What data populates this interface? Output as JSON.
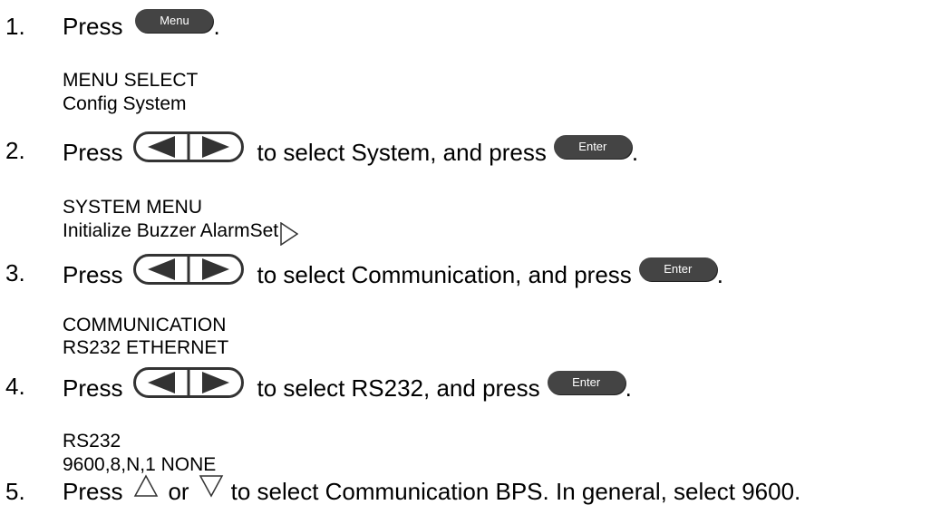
{
  "steps": [
    {
      "num": "1.",
      "pre": "Press",
      "key1": "Menu",
      "post": "."
    },
    {
      "num": "2.",
      "pre": "Press",
      "mid": "to select System, and press",
      "key2": "Enter",
      "post": "."
    },
    {
      "num": "3.",
      "pre": "Press",
      "mid": "to select Communication, and press",
      "key2": "Enter",
      "post": "."
    },
    {
      "num": "4.",
      "pre": "Press",
      "mid": "to select RS232, and press",
      "key2": "Enter",
      "post": "."
    },
    {
      "num": "5.",
      "pre": "Press",
      "or": "or",
      "mid": "to select Communication BPS. In general, select 9600."
    }
  ],
  "displays": [
    {
      "line1": "MENU SELECT",
      "line2": "Config System"
    },
    {
      "line1": "SYSTEM MENU",
      "line2": "Initialize Buzzer AlarmSet"
    },
    {
      "line1": "COMMUNICATION",
      "line2": "RS232 ETHERNET"
    },
    {
      "line1": "RS232",
      "line2": "9600,8,N,1 NONE"
    }
  ],
  "icons": {
    "left_right_keys": "left-right-arrow-keys-icon",
    "right_triangle": "right-triangle-icon",
    "up_triangle": "up-triangle-icon",
    "down_triangle": "down-triangle-icon"
  }
}
